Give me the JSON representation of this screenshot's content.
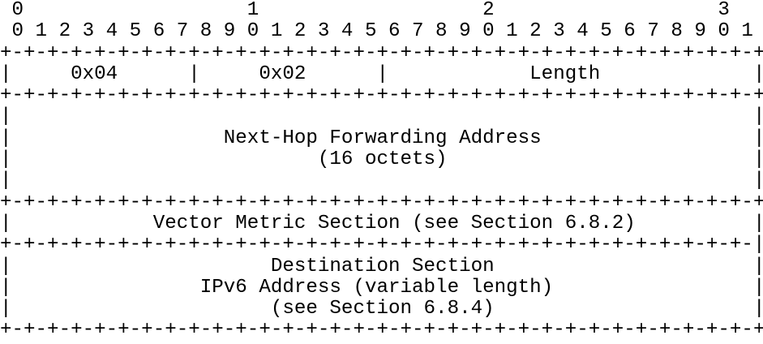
{
  "packet_diagram": {
    "lines": [
      " 0                   1                   2                   3",
      " 0 1 2 3 4 5 6 7 8 9 0 1 2 3 4 5 6 7 8 9 0 1 2 3 4 5 6 7 8 9 0 1",
      "+-+-+-+-+-+-+-+-+-+-+-+-+-+-+-+-+-+-+-+-+-+-+-+-+-+-+-+-+-+-+-+-+",
      "|     0x04      |     0x02      |            Length             |",
      "+-+-+-+-+-+-+-+-+-+-+-+-+-+-+-+-+-+-+-+-+-+-+-+-+-+-+-+-+-+-+-+-+",
      "|                                                               |",
      "|                  Next-Hop Forwarding Address                  |",
      "|                          (16 octets)                          |",
      "|                                                               |",
      "+-+-+-+-+-+-+-+-+-+-+-+-+-+-+-+-+-+-+-+-+-+-+-+-+-+-+-+-+-+-+-+-+",
      "|            Vector Metric Section (see Section 6.8.2)          |",
      "+-+-+-+-+-+-+-+-+-+-+-+-+-+-+-+-+-+-+-+-+-+-+-+-+-+-+-+-+-+-+-+-|",
      "|                      Destination Section                      |",
      "|                IPv6 Address (variable length)                 |",
      "|                      (see Section 6.8.4)                      |",
      "+-+-+-+-+-+-+-+-+-+-+-+-+-+-+-+-+-+-+-+-+-+-+-+-+-+-+-+-+-+-+-+-+"
    ]
  }
}
